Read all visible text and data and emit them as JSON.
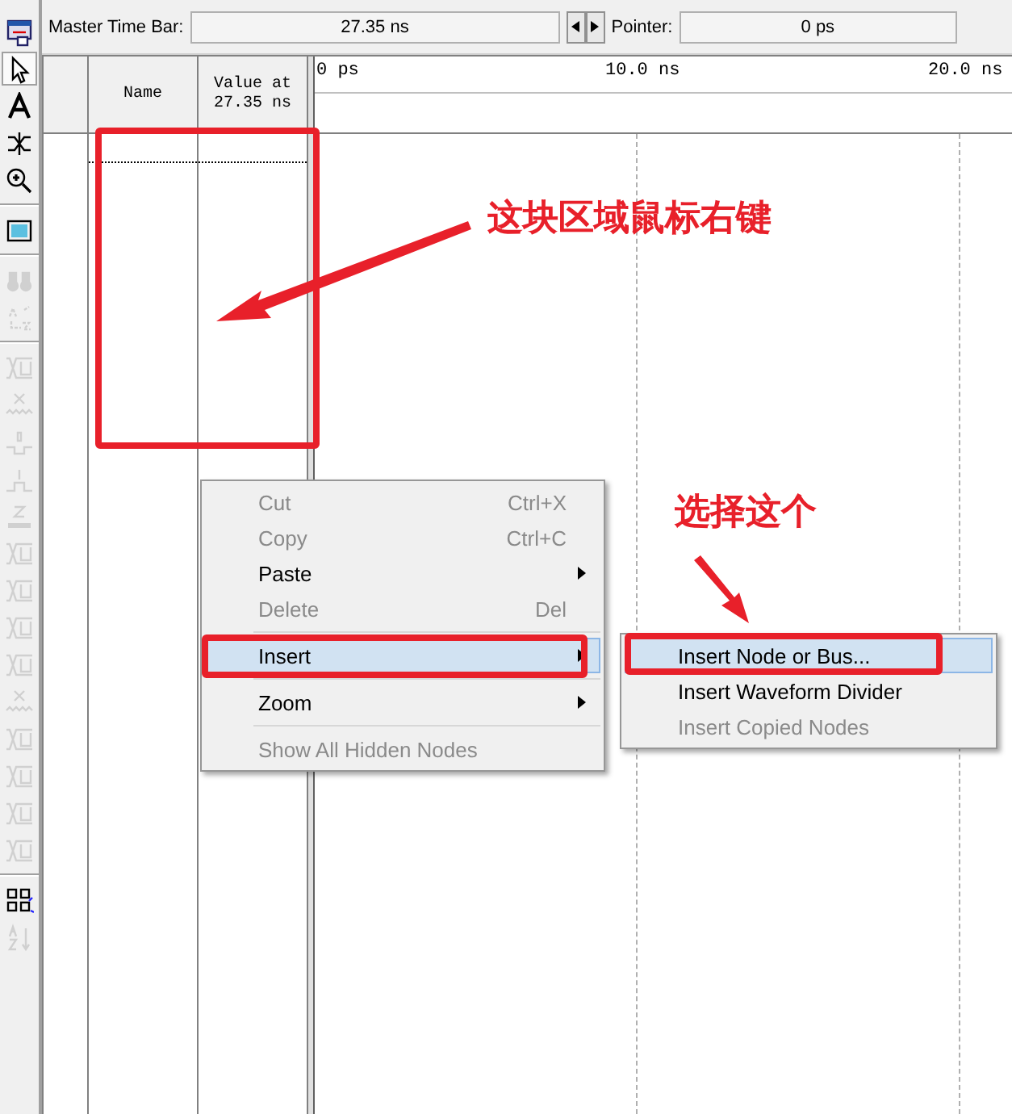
{
  "time_bar": {
    "master_label": "Master Time Bar:",
    "master_value": "27.35 ns",
    "pointer_label": "Pointer:",
    "pointer_value": "0 ps"
  },
  "toolbar": [
    {
      "kind": "window",
      "disabled": false
    },
    {
      "kind": "pointer",
      "disabled": false,
      "selected": true
    },
    {
      "kind": "text",
      "disabled": false,
      "selected": false
    },
    {
      "kind": "node",
      "disabled": false,
      "selected": false
    },
    {
      "kind": "zoom",
      "disabled": false,
      "selected": false
    },
    {
      "kind": "sep"
    },
    {
      "kind": "fullscreen",
      "disabled": false
    },
    {
      "kind": "sep"
    },
    {
      "kind": "find",
      "disabled": true
    },
    {
      "kind": "replace",
      "disabled": true
    },
    {
      "kind": "sep"
    },
    {
      "kind": "wave",
      "disabled": true
    },
    {
      "kind": "cross",
      "disabled": true
    },
    {
      "kind": "low",
      "disabled": true
    },
    {
      "kind": "high",
      "disabled": true
    },
    {
      "kind": "z",
      "disabled": true
    },
    {
      "kind": "wave",
      "disabled": true
    },
    {
      "kind": "wave",
      "disabled": true
    },
    {
      "kind": "wave",
      "disabled": true
    },
    {
      "kind": "wave",
      "disabled": true
    },
    {
      "kind": "cross",
      "disabled": true
    },
    {
      "kind": "wave",
      "disabled": true
    },
    {
      "kind": "wave",
      "disabled": true
    },
    {
      "kind": "wave",
      "disabled": true
    },
    {
      "kind": "wave",
      "disabled": true
    },
    {
      "kind": "sep"
    },
    {
      "kind": "grid",
      "disabled": false
    },
    {
      "kind": "sort",
      "disabled": true
    }
  ],
  "table": {
    "columns": [
      "Name",
      "Value at 27.35 ns"
    ]
  },
  "ruler": [
    "0 ps",
    "10.0 ns",
    "20.0 ns"
  ],
  "context_menu": [
    {
      "kind": "item",
      "label": "Cut",
      "shortcut": "Ctrl+X",
      "disabled": true,
      "submenu": false,
      "selected": false
    },
    {
      "kind": "item",
      "label": "Copy",
      "shortcut": "Ctrl+C",
      "disabled": true,
      "submenu": false,
      "selected": false
    },
    {
      "kind": "item",
      "label": "Paste",
      "disabled": false,
      "submenu": true,
      "selected": false
    },
    {
      "kind": "item",
      "label": "Delete",
      "shortcut": "Del",
      "disabled": true,
      "submenu": false,
      "selected": false
    },
    {
      "kind": "sep"
    },
    {
      "kind": "item",
      "label": "Insert",
      "disabled": false,
      "submenu": true,
      "selected": true
    },
    {
      "kind": "sep"
    },
    {
      "kind": "item",
      "label": "Zoom",
      "disabled": false,
      "submenu": true,
      "selected": false
    },
    {
      "kind": "sep"
    },
    {
      "kind": "item",
      "label": "Show All Hidden Nodes",
      "disabled": true,
      "submenu": false,
      "selected": false
    }
  ],
  "submenu": [
    {
      "label": "Insert Node or Bus...",
      "disabled": false,
      "selected": true
    },
    {
      "label": "Insert Waveform Divider",
      "disabled": false,
      "selected": false
    },
    {
      "label": "Insert Copied Nodes",
      "disabled": true,
      "selected": false
    }
  ],
  "annotations": [
    {
      "text": "这块区域鼠标右键"
    },
    {
      "text": "选择这个"
    }
  ]
}
